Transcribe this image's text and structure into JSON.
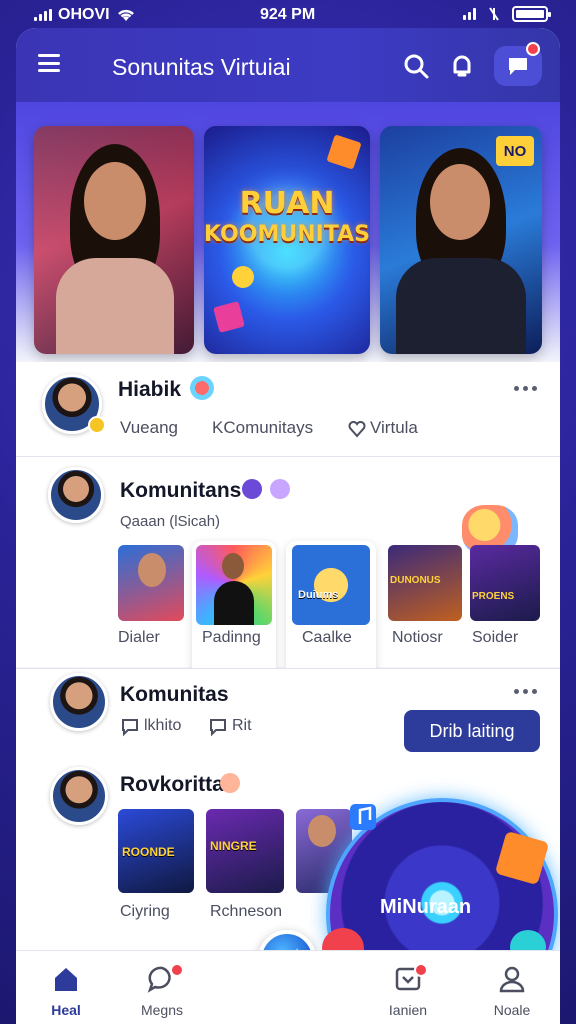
{
  "status_bar": {
    "carrier": "OHOVI",
    "time": "924 PM"
  },
  "header": {
    "title": "Sonunitas Virtuiai",
    "menu_icon": "hamburger-menu-icon",
    "search_icon": "search-icon",
    "notification_icon": "bell-icon",
    "message_icon": "chat-bubble-icon"
  },
  "hero": {
    "banner_title_line1": "RUAN",
    "banner_title_line2": "KOOMUNITAS",
    "badge": "NO"
  },
  "posts": [
    {
      "name": "Hiabik",
      "meta": [
        "Vueang",
        "KComunitays",
        "Virtula"
      ]
    },
    {
      "name": "Komunitans",
      "subtitle": "Qaaan (lSicah)",
      "thumbs": [
        {
          "label": "Dialer",
          "caption": ""
        },
        {
          "label": "Padinng",
          "caption": ""
        },
        {
          "label": "Caalke",
          "caption": "Duiums"
        },
        {
          "label": "Notiosr",
          "caption": "DUNONUS"
        },
        {
          "label": "Soider",
          "caption": "PROENS"
        }
      ]
    },
    {
      "name": "Komunitas",
      "meta": [
        "lkhito",
        "Rit"
      ],
      "button": "Drib laiting"
    },
    {
      "name": "Rovkoritta",
      "thumbs": [
        {
          "label": "Ciyring",
          "caption": "ROONDE"
        },
        {
          "label": "Rchneson",
          "caption": "NINGRE"
        }
      ],
      "music_label": "MiNuraan"
    }
  ],
  "bottom_nav": [
    {
      "label": "Heal",
      "icon": "home-icon",
      "active": true
    },
    {
      "label": "Megns",
      "icon": "message-icon",
      "active": false
    },
    {
      "label": "Ianien",
      "icon": "inbox-icon",
      "active": false
    },
    {
      "label": "Noale",
      "icon": "profile-icon",
      "active": false
    }
  ],
  "colors": {
    "primary": "#3b35b5",
    "accent": "#2d3b9b",
    "badge": "#f0414d"
  }
}
